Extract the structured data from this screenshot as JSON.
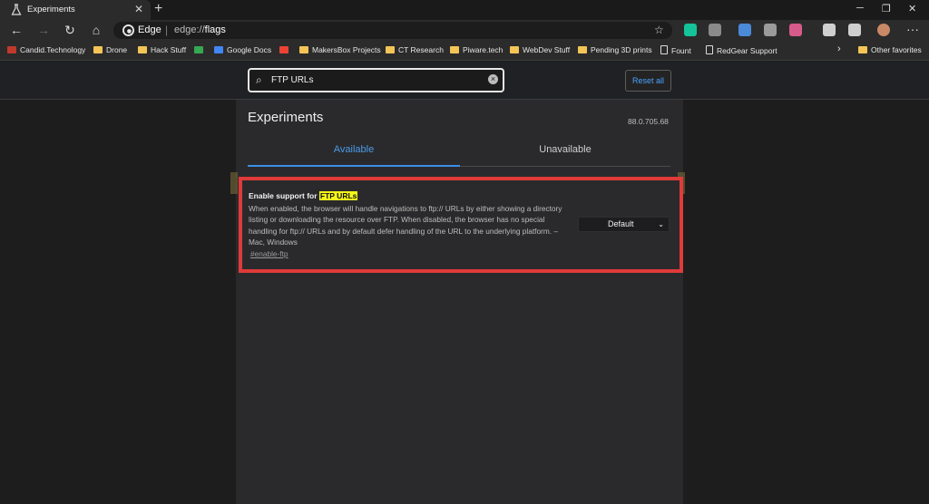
{
  "tab": {
    "title": "Experiments",
    "close": "✕",
    "new": "+"
  },
  "window": {
    "minimize": "─",
    "maximize": "❐",
    "close": "✕"
  },
  "nav": {
    "back": "←",
    "forward": "→",
    "refresh": "↻",
    "home": "⌂"
  },
  "omnibox": {
    "site": "Edge",
    "separator": "|",
    "url_prefix": "edge://",
    "url_path": "flags",
    "star": "☆"
  },
  "extensions": [
    {
      "name": "grammarly-icon",
      "color": "#15c39a"
    },
    {
      "name": "extension-icon-2",
      "color": "#8a8a8a"
    },
    {
      "name": "extension-icon-3",
      "color": "#4a8ad8"
    },
    {
      "name": "extension-icon-4",
      "color": "#9a9a9a"
    },
    {
      "name": "extension-icon-5",
      "color": "#d65a8a"
    },
    {
      "name": "favorites-icon",
      "color": "#cfcfcf"
    },
    {
      "name": "collections-icon",
      "color": "#cfcfcf"
    },
    {
      "name": "profile-icon",
      "color": "#c98866"
    }
  ],
  "menu_dots": "···",
  "bookmarks": [
    {
      "label": "Candid.Technology",
      "kind": "site",
      "color": "#c0392b"
    },
    {
      "label": "Drone",
      "kind": "folder"
    },
    {
      "label": "Hack Stuff",
      "kind": "folder"
    },
    {
      "label": "",
      "kind": "site",
      "color": "#34a853"
    },
    {
      "label": "Google Docs",
      "kind": "site",
      "color": "#4285f4"
    },
    {
      "label": "",
      "kind": "site",
      "color": "#ea4335"
    },
    {
      "label": "MakersBox Projects",
      "kind": "folder"
    },
    {
      "label": "CT Research",
      "kind": "folder"
    },
    {
      "label": "Piware.tech",
      "kind": "folder"
    },
    {
      "label": "WebDev Stuff",
      "kind": "folder"
    },
    {
      "label": "Pending 3D prints",
      "kind": "folder"
    },
    {
      "label": "Fount",
      "kind": "page"
    },
    {
      "label": "RedGear Support",
      "kind": "page"
    }
  ],
  "bookmarks_more": "›",
  "other_favorites": "Other favorites",
  "search": {
    "value": "FTP URLs",
    "mag": "⌕",
    "clear": "×"
  },
  "reset_all": "Reset all",
  "page": {
    "title": "Experiments",
    "version": "88.0.705.68",
    "tab_available": "Available",
    "tab_unavailable": "Unavailable"
  },
  "flag": {
    "name_prefix": "Enable support for ",
    "name_highlight": "FTP URLs",
    "description": "When enabled, the browser will handle navigations to ftp:// URLs by either showing a directory listing or downloading the resource over FTP. When disabled, the browser has no special handling for ftp:// URLs and by default defer handling of the URL to the underlying platform. – Mac, Windows",
    "link": "#enable-ftp",
    "select_value": "Default",
    "select_chevron": "⌄"
  }
}
